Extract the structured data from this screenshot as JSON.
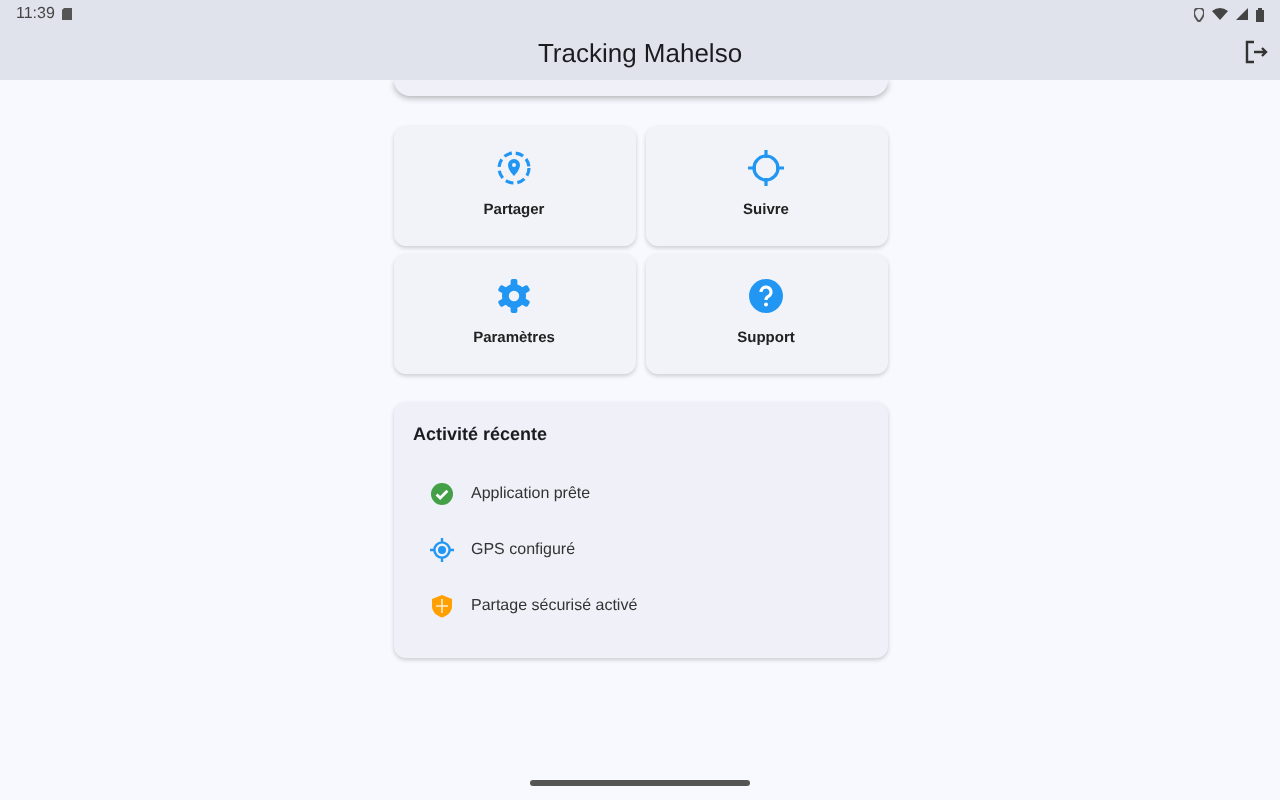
{
  "status_bar": {
    "time": "11:39"
  },
  "app_bar": {
    "title": "Tracking Mahelso"
  },
  "actions": [
    {
      "kind": "share",
      "label": "Partager"
    },
    {
      "kind": "track",
      "label": "Suivre"
    },
    {
      "kind": "settings",
      "label": "Paramètres"
    },
    {
      "kind": "help",
      "label": "Support"
    }
  ],
  "recent_activity": {
    "title": "Activité récente",
    "items": [
      {
        "kind": "check",
        "text": "Application prête"
      },
      {
        "kind": "gps",
        "text": "GPS configuré"
      },
      {
        "kind": "shield",
        "text": "Partage sécurisé activé"
      }
    ]
  }
}
